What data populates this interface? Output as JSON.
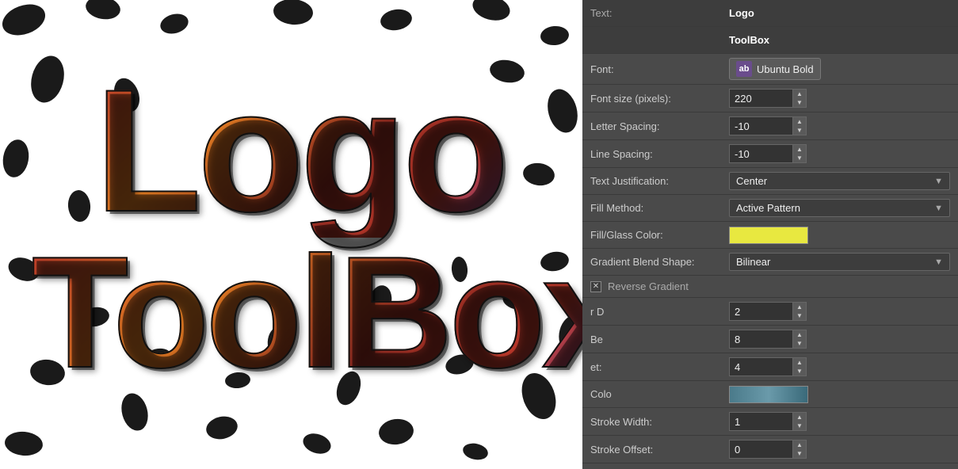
{
  "canvas": {
    "logo_line1": "Logo",
    "logo_line2": "ToolBox"
  },
  "panel": {
    "title": "ToolBox",
    "text_label": "Text:",
    "text_value": "Logo",
    "toolbox_value": "ToolBox",
    "font_label": "Font:",
    "font_value": "Ubuntu Bold",
    "font_size_label": "Font size (pixels):",
    "font_size_value": "220",
    "letter_spacing_label": "Letter Spacing:",
    "letter_spacing_value": "-10",
    "line_spacing_label": "Line Spacing:",
    "line_spacing_value": "-10",
    "text_justification_label": "Text Justification:",
    "text_justification_value": "Center",
    "fill_method_label": "Fill Method:",
    "fill_method_value": "Active Pattern",
    "fill_glass_label": "Fill/Glass Color:",
    "gradient_blend_label": "Gradient Blend Shape:",
    "gradient_blend_value": "Bilinear",
    "reverse_gradient_label": "Reverse Gradient",
    "r_d_label": "r D",
    "r_d_value": "2",
    "be_label": "Be",
    "be_value": "8",
    "et_label": "et:",
    "et_value": "4",
    "col_label": "Colo",
    "stroke_width_label": "Stroke Width:",
    "stroke_width_value": "1",
    "stroke_offset_label": "Stroke Offset:",
    "stroke_offset_value": "0"
  }
}
